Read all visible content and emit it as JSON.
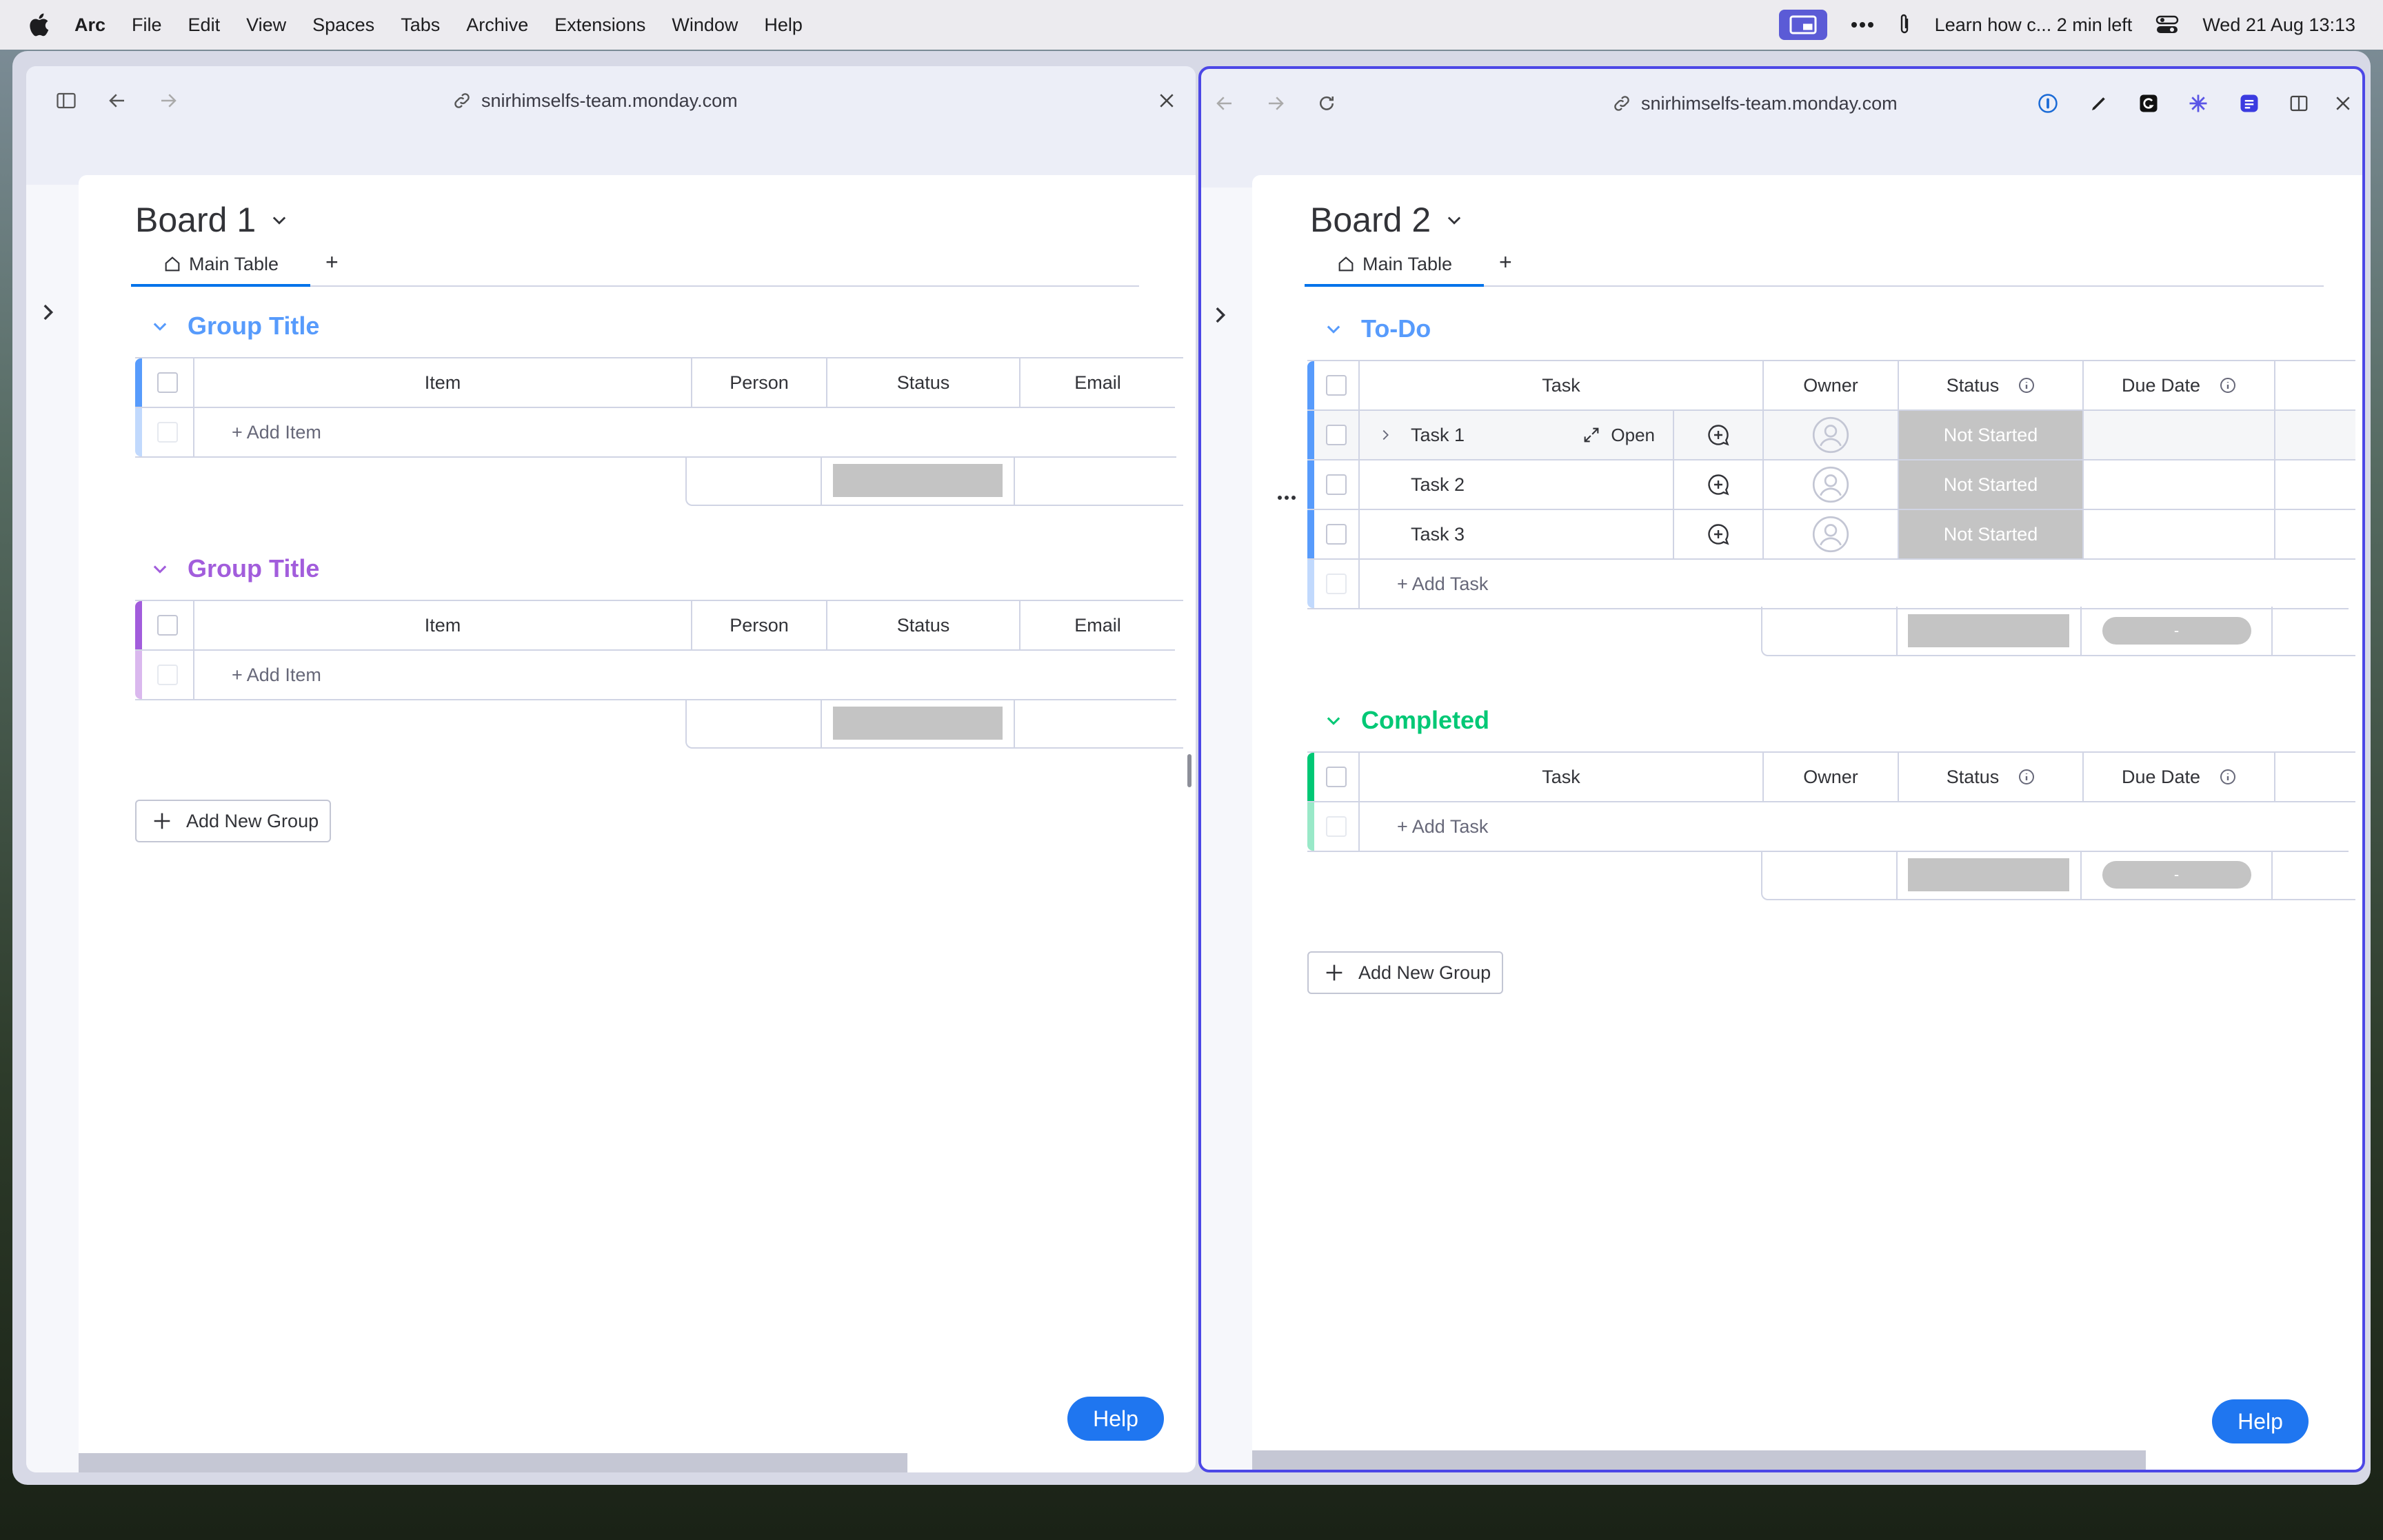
{
  "menubar": {
    "app": "Arc",
    "items": [
      "File",
      "Edit",
      "View",
      "Spaces",
      "Tabs",
      "Archive",
      "Extensions",
      "Window",
      "Help"
    ],
    "status_text": "Learn how c... 2 min left",
    "datetime": "Wed 21 Aug  13:13"
  },
  "left": {
    "url": "snirhimselfs-team.monday.com",
    "board_title": "Board 1",
    "tab_main": "Main Table",
    "tab_add": "+",
    "groups": [
      {
        "title": "Group Title",
        "color": "#579bfc",
        "columns": [
          "Item",
          "Person",
          "Status",
          "Email"
        ],
        "add_label": "+ Add Item"
      },
      {
        "title": "Group Title",
        "color": "#a25ddc",
        "columns": [
          "Item",
          "Person",
          "Status",
          "Email"
        ],
        "add_label": "+ Add Item"
      }
    ],
    "add_group": "Add New Group",
    "help": "Help"
  },
  "right": {
    "url": "snirhimselfs-team.monday.com",
    "board_title": "Board 2",
    "tab_main": "Main Table",
    "tab_add": "+",
    "groups": [
      {
        "title": "To-Do",
        "color": "#579bfc",
        "columns": [
          "Task",
          "Owner",
          "Status",
          "Due Date"
        ],
        "rows": [
          {
            "task": "Task 1",
            "status": "Not Started",
            "open": "Open"
          },
          {
            "task": "Task 2",
            "status": "Not Started"
          },
          {
            "task": "Task 3",
            "status": "Not Started"
          }
        ],
        "add_label": "+ Add Task",
        "summary_pill": "-"
      },
      {
        "title": "Completed",
        "color": "#00c875",
        "columns": [
          "Task",
          "Owner",
          "Status",
          "Due Date"
        ],
        "add_label": "+ Add Task",
        "summary_pill": "-"
      }
    ],
    "add_group": "Add New Group",
    "help": "Help"
  },
  "colors": {
    "accent": "#0073ea",
    "arc_border": "#4c47e6",
    "help": "#1f76f0"
  }
}
